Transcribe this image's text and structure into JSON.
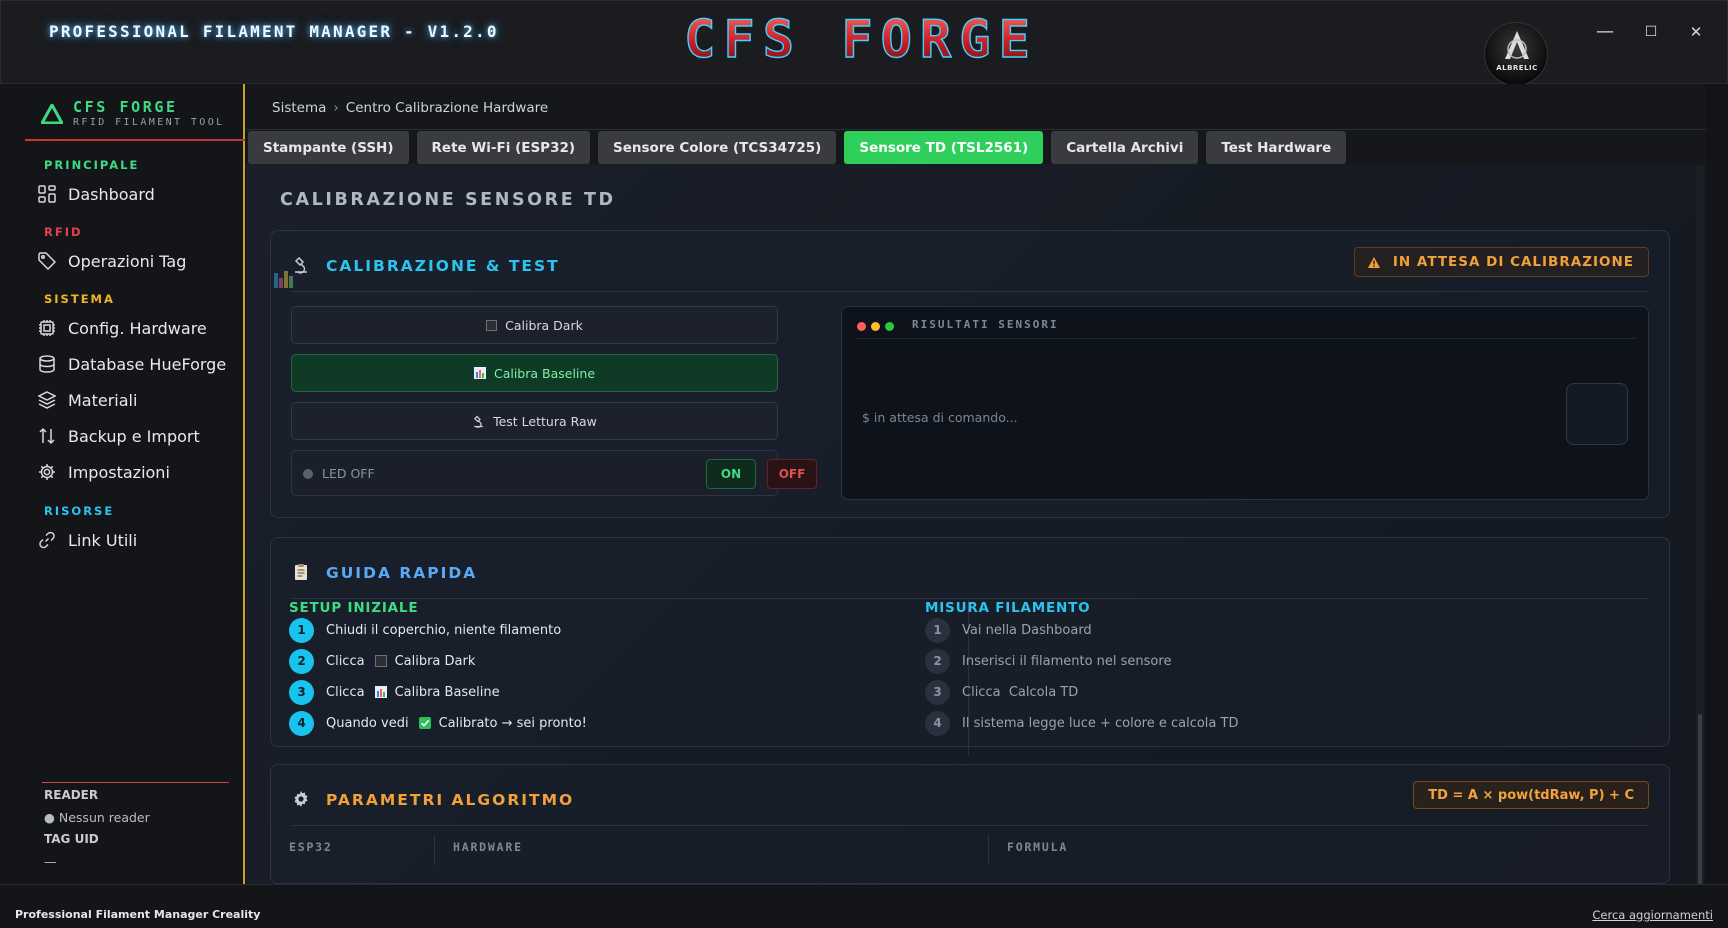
{
  "app": {
    "title": "PROFESSIONAL FILAMENT MANAGER - V1.2.0",
    "brand": "CFS FORGE",
    "avatar_label": "ALBRELIC"
  },
  "window_controls": {
    "minimize": "—",
    "maximize": "☐",
    "close": "✕"
  },
  "sidebar": {
    "logo_title": "CFS FORGE",
    "logo_subtitle": "RFID FILAMENT TOOL",
    "sections": [
      {
        "label": "PRINCIPALE",
        "color": "#3ddc84"
      },
      {
        "label": "RFID",
        "color": "#e0434f"
      },
      {
        "label": "SISTEMA",
        "color": "#f0b429"
      },
      {
        "label": "RISORSE",
        "color": "#2bc4f0"
      }
    ],
    "items": [
      {
        "label": "Dashboard",
        "icon": "dashboard-grid-icon"
      },
      {
        "label": "Operazioni Tag",
        "icon": "tag-icon"
      },
      {
        "label": "Config. Hardware",
        "icon": "chip-icon"
      },
      {
        "label": "Database HueForge",
        "icon": "database-icon"
      },
      {
        "label": "Materiali",
        "icon": "layers-icon"
      },
      {
        "label": "Backup e Import",
        "icon": "arrows-updown-icon"
      },
      {
        "label": "Impostazioni",
        "icon": "gear-icon"
      },
      {
        "label": "Link Utili",
        "icon": "link-icon"
      }
    ],
    "reader_label": "READER",
    "reader_value": "● Nessun reader",
    "tag_uid_label": "TAG UID",
    "tag_uid_value": "—"
  },
  "breadcrumb": {
    "root": "Sistema",
    "sep": "›",
    "current": "Centro Calibrazione Hardware"
  },
  "tabs": [
    {
      "label": "Stampante (SSH)",
      "active": false
    },
    {
      "label": "Rete Wi-Fi (ESP32)",
      "active": false
    },
    {
      "label": "Sensore Colore (TCS34725)",
      "active": false
    },
    {
      "label": "Sensore TD (TSL2561)",
      "active": true
    },
    {
      "label": "Cartella Archivi",
      "active": false
    },
    {
      "label": "Test Hardware",
      "active": false
    }
  ],
  "page": {
    "title": "CALIBRAZIONE SENSORE TD"
  },
  "calibration": {
    "title": "CALIBRAZIONE & TEST",
    "status": "IN ATTESA DI CALIBRAZIONE",
    "buttons": {
      "dark": "Calibra Dark",
      "baseline": "Calibra Baseline",
      "raw": "Test Lettura Raw"
    },
    "led_label": "LED OFF",
    "led_on": "ON",
    "led_off": "OFF",
    "terminal_title": "RISULTATI SENSORI",
    "terminal_output": "$ in attesa di comando..."
  },
  "guide": {
    "title": "GUIDA RAPIDA",
    "setup": {
      "title": "SETUP INIZIALE",
      "steps": [
        {
          "n": "1",
          "text": "Chiudi il coperchio, niente filamento"
        },
        {
          "n": "2",
          "pre": "Clicca",
          "text": "Calibra Dark"
        },
        {
          "n": "3",
          "pre": "Clicca",
          "text": "Calibra Baseline"
        },
        {
          "n": "4",
          "pre": "Quando vedi",
          "text": "Calibrato → sei pronto!"
        }
      ]
    },
    "measure": {
      "title": "MISURA FILAMENTO",
      "steps": [
        {
          "n": "1",
          "text": "Vai nella Dashboard"
        },
        {
          "n": "2",
          "text": "Inserisci il filamento nel sensore"
        },
        {
          "n": "3",
          "text": "Clicca  Calcola TD"
        },
        {
          "n": "4",
          "text": "Il sistema legge luce + colore e calcola TD"
        }
      ]
    }
  },
  "params": {
    "title": "PARAMETRI ALGORITMO",
    "formula": "TD = A × pow(tdRaw, P) + C",
    "columns": [
      "ESP32",
      "HARDWARE",
      "FORMULA"
    ]
  },
  "footer": {
    "left": "Professional Filament Manager Creality",
    "right": "Cerca aggiornamenti"
  },
  "colors": {
    "accent_green": "#2fcf5c",
    "accent_cyan": "#2bc4f0",
    "accent_orange": "#f0a13a",
    "sidebar_border": "#c9a227"
  }
}
